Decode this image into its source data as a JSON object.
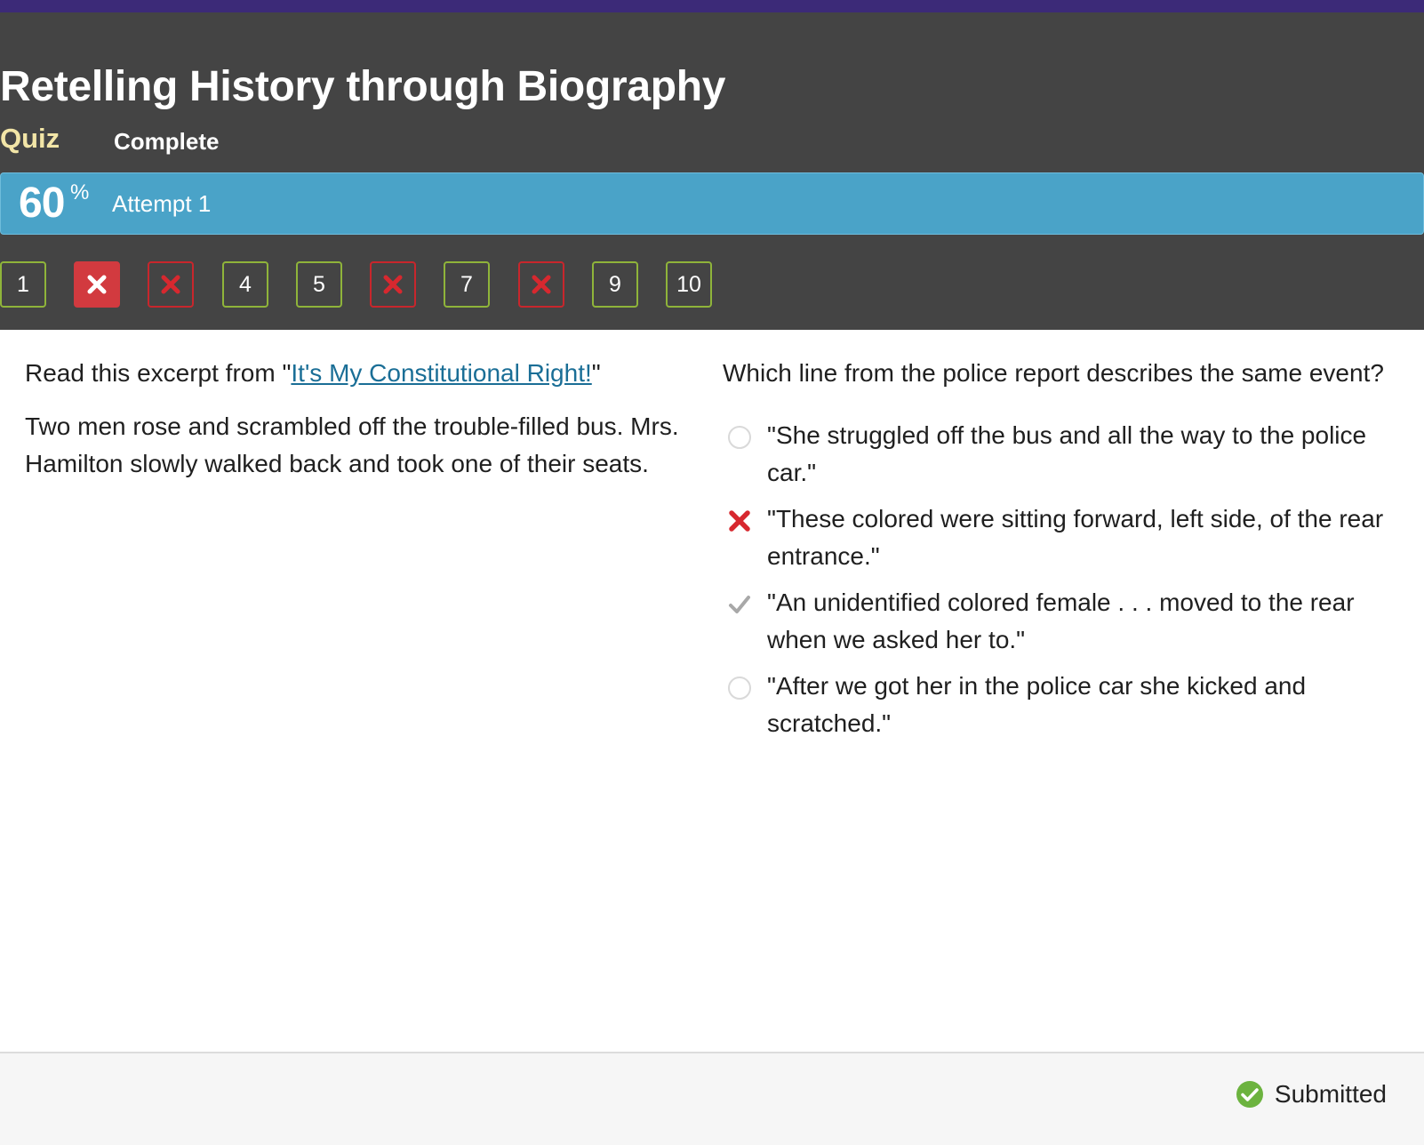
{
  "header": {
    "title": "Retelling History through Biography",
    "type_label": "Quiz",
    "status_label": "Complete",
    "score_value": "60",
    "score_unit": "%",
    "attempt_label": "Attempt 1"
  },
  "question_nav": [
    {
      "label": "1",
      "state": "answered"
    },
    {
      "label": "",
      "state": "incorrect-current",
      "icon": "x-icon"
    },
    {
      "label": "",
      "state": "incorrect",
      "icon": "x-icon"
    },
    {
      "label": "4",
      "state": "answered"
    },
    {
      "label": "5",
      "state": "answered"
    },
    {
      "label": "",
      "state": "incorrect",
      "icon": "x-icon"
    },
    {
      "label": "7",
      "state": "answered"
    },
    {
      "label": "",
      "state": "incorrect",
      "icon": "x-icon"
    },
    {
      "label": "9",
      "state": "answered"
    },
    {
      "label": "10",
      "state": "answered"
    }
  ],
  "passage": {
    "intro_before": "Read this excerpt from \"",
    "link_text": "It's My Constitutional Right!",
    "intro_after": "\"",
    "body": "Two men rose and scrambled off the trouble-filled bus. Mrs. Hamilton slowly walked back and took one of their seats."
  },
  "question": {
    "prompt": "Which line from the police report describes the same event?",
    "options": [
      {
        "text": "\"She struggled off the bus and all the way to the police car.\"",
        "state": "unselected"
      },
      {
        "text": "\"These colored were sitting forward, left side, of the rear entrance.\"",
        "state": "selected-incorrect"
      },
      {
        "text": "\"An unidentified colored female . . . moved to the rear when we asked her to.\"",
        "state": "correct-answer"
      },
      {
        "text": "\"After we got her in the police car she kicked and scratched.\"",
        "state": "unselected"
      }
    ]
  },
  "footer": {
    "status_text": "Submitted"
  },
  "colors": {
    "topbar": "#3c2a78",
    "header_bg": "#444444",
    "score_bar": "#4aa3c8",
    "quiz_label": "#f2e5a7",
    "correct_border": "#8fb43a",
    "incorrect": "#c8262c",
    "link": "#1a6e96",
    "submitted_check": "#6cb33f"
  }
}
